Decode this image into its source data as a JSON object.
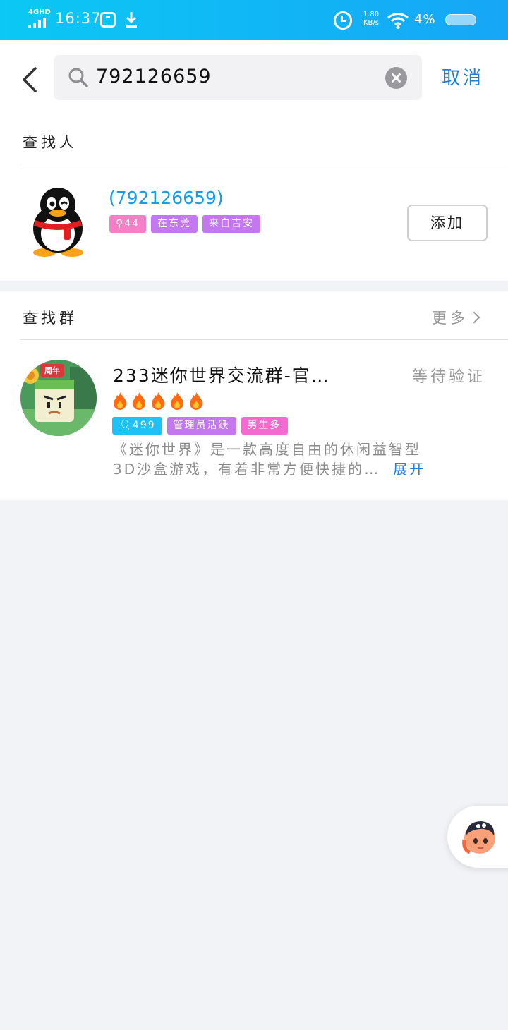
{
  "status_bar": {
    "network": "4GHD",
    "time": "16:37",
    "speed_value": "1.80",
    "speed_unit": "KB/s",
    "battery": "4%"
  },
  "search": {
    "query": "792126659",
    "cancel_label": "取消"
  },
  "people_section": {
    "title": "查找人",
    "result": {
      "name": "(792126659)",
      "tags": [
        {
          "label": "♀44",
          "color": "#f47fc6"
        },
        {
          "label": "在东莞",
          "color": "#c378f0"
        },
        {
          "label": "来自吉安",
          "color": "#c378f0"
        }
      ],
      "add_label": "添加"
    }
  },
  "group_section": {
    "title": "查找群",
    "more_label": "更多",
    "result": {
      "name": "233迷你世界交流群-官…",
      "status": "等待验证",
      "fire_count": 5,
      "avatar_badge": "周年",
      "tags": [
        {
          "label": "499",
          "color": "#1fc2f6"
        },
        {
          "label": "管理员活跃",
          "color": "#c378f0"
        },
        {
          "label": "男生多",
          "color": "#f36bd1"
        }
      ],
      "description_line1": "《迷你世界》是一款高度自由的休闲益智型",
      "description_line2": "3D沙盒游戏，有着非常方便快捷的…",
      "expand_label": "展开"
    }
  },
  "colors": {
    "accent_blue": "#1d7fe0",
    "link_blue": "#1a9be6",
    "status_bar_start": "#0bc8f4",
    "status_bar_end": "#16a6f6",
    "page_background": "#f2f3f7"
  }
}
